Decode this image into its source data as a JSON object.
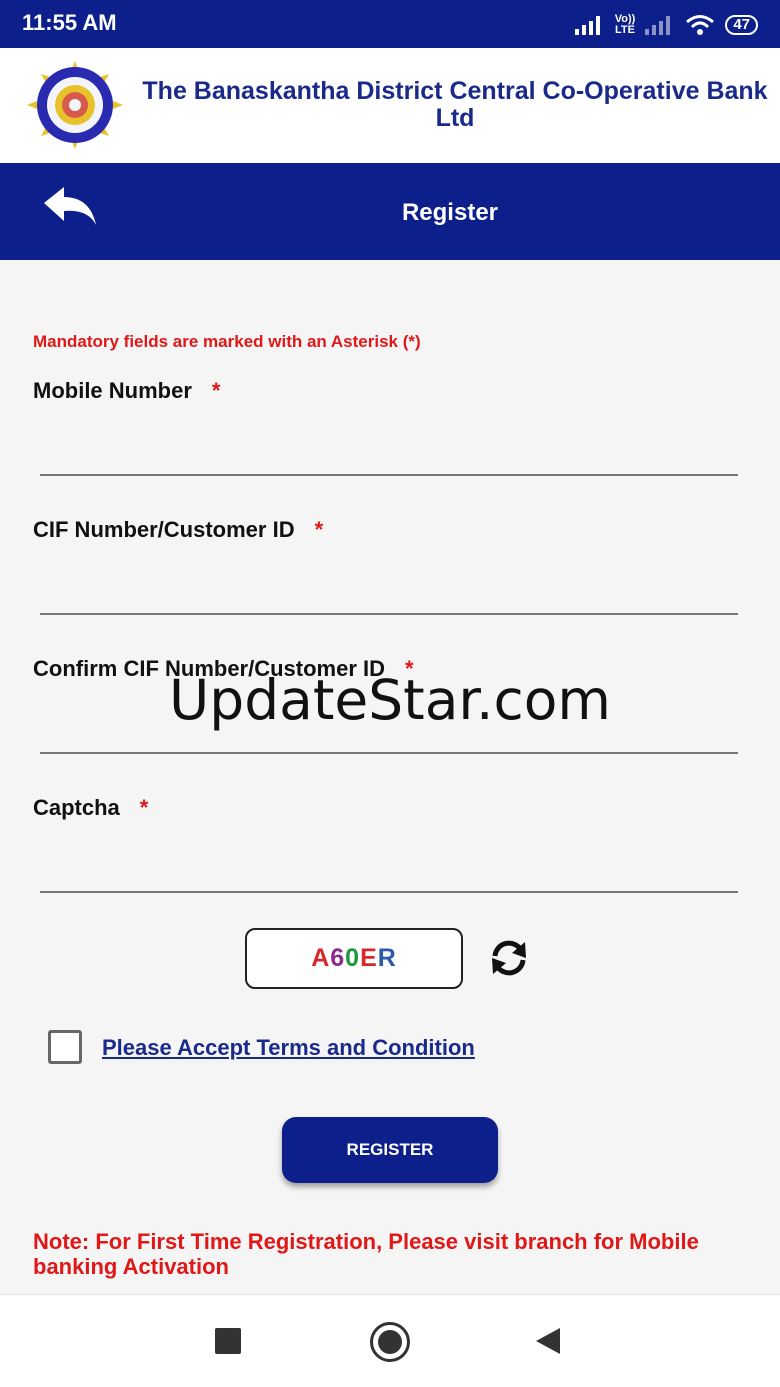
{
  "status_bar": {
    "time": "11:55 AM",
    "network_label_top": "Vo))",
    "network_label_bottom": "LTE",
    "battery": "47"
  },
  "header": {
    "bank_name": "The Banaskantha District Central Co-Operative Bank Ltd"
  },
  "nav": {
    "title": "Register"
  },
  "form": {
    "mandatory_note": "Mandatory fields are marked with an Asterisk (*)",
    "mobile_label": "Mobile Number",
    "cif_label": "CIF Number/Customer ID",
    "confirm_cif_label": "Confirm CIF Number/Customer ID",
    "captcha_label": "Captcha",
    "required_marker": "*",
    "mobile_value": "",
    "cif_value": "",
    "confirm_cif_value": "",
    "captcha_value": "",
    "captcha_chars": [
      {
        "char": "A",
        "color": "#d8282b"
      },
      {
        "char": "6",
        "color": "#8a2a8a"
      },
      {
        "char": "0",
        "color": "#1a9a3a"
      },
      {
        "char": "E",
        "color": "#d8282b"
      },
      {
        "char": "R",
        "color": "#2a5aa8"
      }
    ],
    "terms_label": "Please Accept Terms and Condition",
    "terms_checked": false,
    "register_label": "REGISTER",
    "note": "Note: For First Time Registration, Please visit branch for Mobile banking Activation"
  },
  "watermark": "UpdateStar.com",
  "colors": {
    "primary": "#0d1f8a",
    "accent_red": "#e01818",
    "link": "#1a2a8a"
  },
  "icons": {
    "back": "back-arrow-icon",
    "refresh": "refresh-icon",
    "bank_logo": "bank-logo",
    "nav_recent": "square-icon",
    "nav_home": "circle-home-icon",
    "nav_back": "triangle-back-icon"
  }
}
